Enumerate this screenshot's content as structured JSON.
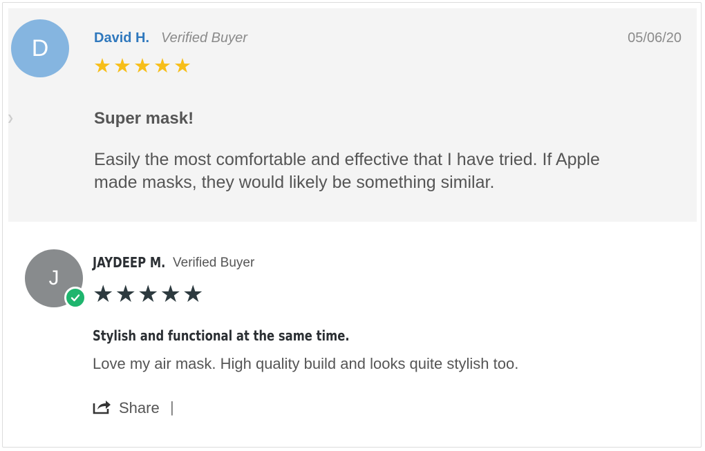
{
  "review1": {
    "avatar_initial": "D",
    "name": "David H.",
    "verified": "Verified Buyer",
    "date": "05/06/20",
    "rating": 5,
    "star_color": "#f7be19",
    "title": "Super mask!",
    "body": "Easily the most comfortable and effective that I have tried. If Apple made masks, they would likely be something similar."
  },
  "review2": {
    "avatar_initial": "J",
    "name": "JAYDEEP M.",
    "verified": "Verified Buyer",
    "rating": 5,
    "star_color": "#2d3a3f",
    "badge_icon": "check-icon",
    "badge_color": "#1fb56e",
    "title": "Stylish and functional at the same time.",
    "body": "Love my air mask. High quality build and looks quite stylish too.",
    "share_label": "Share",
    "divider": "|"
  }
}
